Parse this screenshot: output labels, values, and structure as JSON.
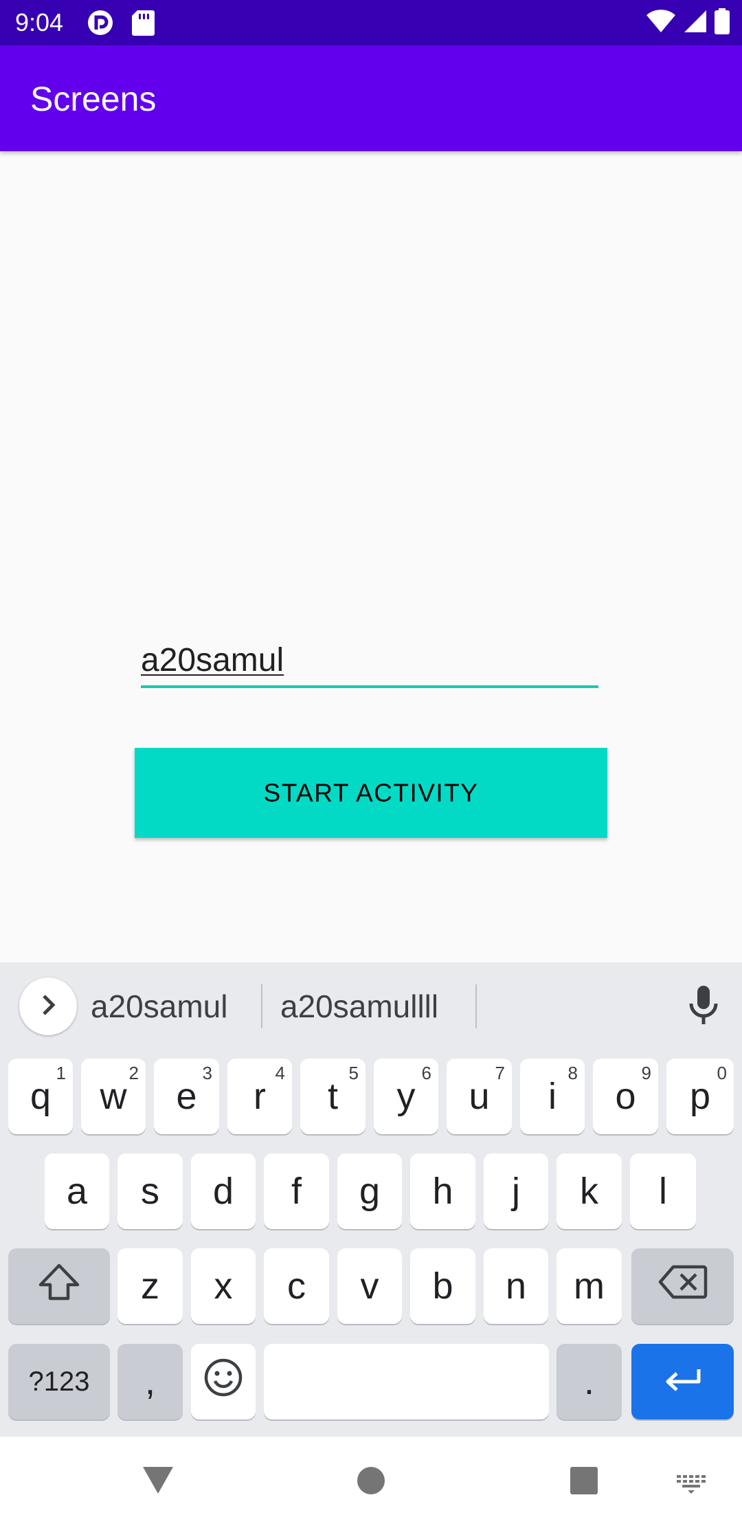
{
  "status_bar": {
    "time": "9:04",
    "notification_icons": [
      "pocket-casts-icon",
      "sd-card-icon"
    ],
    "system_icons": [
      "wifi-icon",
      "cell-signal-icon",
      "battery-icon"
    ]
  },
  "app_bar": {
    "title": "Screens",
    "color": "#6200ee"
  },
  "form": {
    "text_value": "a20samul",
    "button_label": "START ACTIVITY",
    "accent_color": "#03dac5"
  },
  "keyboard": {
    "suggestions": [
      "a20samul",
      "a20samullll"
    ],
    "row1": [
      {
        "label": "q",
        "hint": "1"
      },
      {
        "label": "w",
        "hint": "2"
      },
      {
        "label": "e",
        "hint": "3"
      },
      {
        "label": "r",
        "hint": "4"
      },
      {
        "label": "t",
        "hint": "5"
      },
      {
        "label": "y",
        "hint": "6"
      },
      {
        "label": "u",
        "hint": "7"
      },
      {
        "label": "i",
        "hint": "8"
      },
      {
        "label": "o",
        "hint": "9"
      },
      {
        "label": "p",
        "hint": "0"
      }
    ],
    "row2": [
      "a",
      "s",
      "d",
      "f",
      "g",
      "h",
      "j",
      "k",
      "l"
    ],
    "row3": [
      "z",
      "x",
      "c",
      "v",
      "b",
      "n",
      "m"
    ],
    "symbols_label": "?123",
    "comma_label": ",",
    "period_label": ".",
    "enter_color": "#1a73e8"
  },
  "nav_bar": {
    "items": [
      "back-icon",
      "home-icon",
      "recents-icon",
      "keyboard-switch-icon"
    ]
  }
}
